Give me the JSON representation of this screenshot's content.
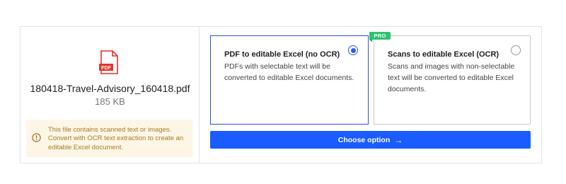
{
  "file": {
    "icon": "pdf-file-icon",
    "icon_label": "PDF",
    "name": "180418-Travel-Advisory_160418.pdf",
    "size": "185 KB"
  },
  "warning": {
    "icon": "exclamation-circle-icon",
    "text": "This file contains scanned text or images. Convert with OCR text extraction to create an editable Excel document."
  },
  "options": [
    {
      "title": "PDF to editable Excel (no OCR)",
      "description": "PDFs with selectable text will be converted to editable Excel documents.",
      "selected": true
    },
    {
      "title": "Scans to editable Excel (OCR)",
      "description": "Scans and images with non-selectable text will be converted to editable Excel documents.",
      "selected": false,
      "badge": "PRO"
    }
  ],
  "action": {
    "label": "Choose option",
    "icon": "arrow-right-icon",
    "arrow": "→"
  },
  "colors": {
    "accent": "#1a5cff",
    "selected_border": "#2b50d8",
    "pdf_red": "#e5322d",
    "pro_green": "#2fc26f",
    "warning_bg": "#fdf6e6",
    "warning_text": "#a77b25"
  }
}
